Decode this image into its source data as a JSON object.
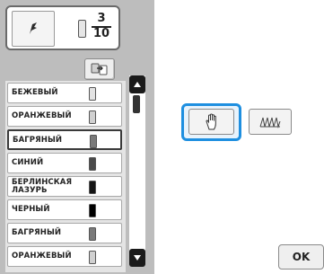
{
  "thread_counter": {
    "current": "3",
    "total": "10"
  },
  "color_list": [
    {
      "name": "БЕЖЕВЫЙ",
      "swatch": "#e3e3e3",
      "selected": false
    },
    {
      "name": "ОРАНЖЕВЫЙ",
      "swatch": "#d0d0d0",
      "selected": false
    },
    {
      "name": "БАГРЯНЫЙ",
      "swatch": "#7a7a7a",
      "selected": true
    },
    {
      "name": "СИНИЙ",
      "swatch": "#4a4a4a",
      "selected": false
    },
    {
      "name": "БЕРЛИНСКАЯ ЛАЗУРЬ",
      "swatch": "#151515",
      "selected": false
    },
    {
      "name": "ЧЕРНЫЙ",
      "swatch": "#000000",
      "selected": false
    },
    {
      "name": "БАГРЯНЫЙ",
      "swatch": "#7a7a7a",
      "selected": false
    },
    {
      "name": "ОРАНЖЕВЫЙ",
      "swatch": "#d0d0d0",
      "selected": false
    }
  ],
  "buttons": {
    "ok_label": "OK"
  },
  "colors": {
    "highlight": "#1e8fe0",
    "panel_bg": "#bdbdbd"
  }
}
